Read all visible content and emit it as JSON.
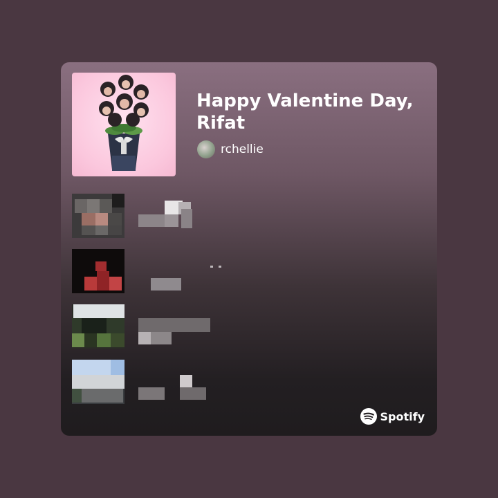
{
  "playlist": {
    "title": "Happy Valentine Day, Rifat",
    "owner": "rchellie",
    "cover_icon": "bouquet-cover-art",
    "tracks_redacted": 4
  },
  "brand": {
    "name": "Spotify",
    "color": "#ffffff"
  },
  "colors": {
    "background": "#4a3741",
    "card_top": "#8a6f80",
    "card_bottom": "#1f1c1e",
    "cover_pink": "#fbc7dd"
  }
}
